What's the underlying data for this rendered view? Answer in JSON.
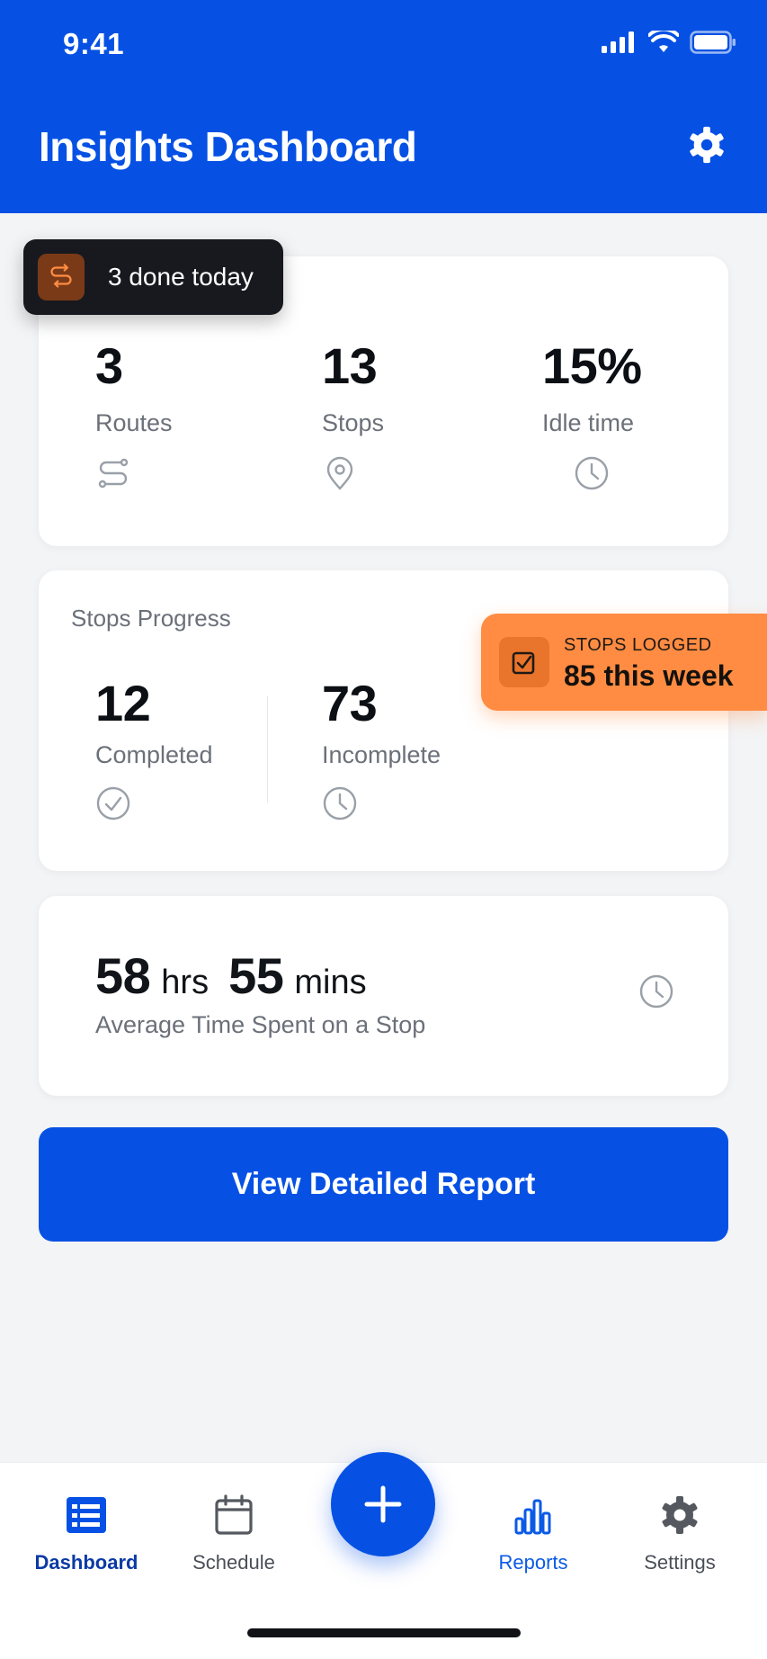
{
  "status_bar": {
    "time": "9:41"
  },
  "header": {
    "title": "Insights Dashboard"
  },
  "summary": {
    "stats": [
      {
        "value": "3",
        "label": "Routes",
        "icon": "route-icon"
      },
      {
        "value": "13",
        "label": "Stops",
        "icon": "map-pin-icon"
      },
      {
        "value": "15%",
        "label": "Idle time",
        "icon": "clock-icon"
      }
    ]
  },
  "toast_done": {
    "text": "3 done today"
  },
  "progress": {
    "title": "Stops Progress",
    "completed": {
      "value": "12",
      "label": "Completed"
    },
    "incomplete": {
      "value": "73",
      "label": "Incomplete"
    }
  },
  "toast_logged": {
    "kicker": "STOPS LOGGED",
    "value": "85 this week"
  },
  "avg_time": {
    "hours": "58",
    "hours_unit": "hrs",
    "minutes": "55",
    "minutes_unit": "mins",
    "caption": "Average Time Spent on a Stop"
  },
  "cta": {
    "label": "View Detailed Report"
  },
  "tabbar": {
    "items": [
      {
        "label": "Dashboard",
        "icon": "dashboard-icon",
        "active": true
      },
      {
        "label": "Schedule",
        "icon": "calendar-icon"
      },
      {
        "label": "Reports",
        "icon": "bar-chart-icon"
      },
      {
        "label": "Settings",
        "icon": "gear-icon"
      }
    ],
    "fab_icon": "plus-icon"
  },
  "colors": {
    "primary": "#0651e4",
    "accent": "#ff8c42",
    "dark_toast": "#17191e",
    "muted": "#6b7079"
  }
}
